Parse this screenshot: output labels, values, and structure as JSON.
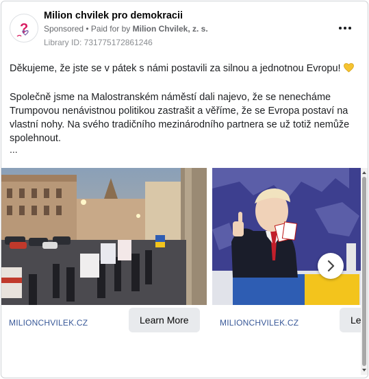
{
  "post": {
    "page_name": "Milion chvilek pro demokracii",
    "sponsored": "Sponsored",
    "paid_for_prefix": "• Paid for by",
    "paid_for_org": "Milion Chvilek, z. s.",
    "library_id": "Library ID: 731775172861246",
    "more_icon": "more-horizontal-icon",
    "paragraph_1": "Děkujeme, že jste se v pátek s námi postavili za silnou a jednotnou Evropu!",
    "paragraph_1_emoji": "yellow-heart-icon",
    "paragraph_2": "Společně jsme na Malostranském náměstí dali najevo, že se nenecháme Trumpovou nenávistnou politikou zastrašit a věříme, že se Evropa postaví na vlastní nohy. Na svého tradičního mezinárodního partnera se už totiž nemůže spolehnout.",
    "ellipsis": "..."
  },
  "carousel": {
    "cards": [
      {
        "domain": "MILIONCHVILEK.CZ",
        "cta": "Learn More",
        "image": "demonstration-photo"
      },
      {
        "domain": "MILIONCHVILEK.CZ",
        "cta": "Learn More",
        "image": "trump-caricature-photo"
      }
    ],
    "next_icon": "chevron-right-icon"
  },
  "colors": {
    "link_blue": "#385898",
    "button_bg": "#e8eaed",
    "avatar_pink": "#c2185b"
  }
}
